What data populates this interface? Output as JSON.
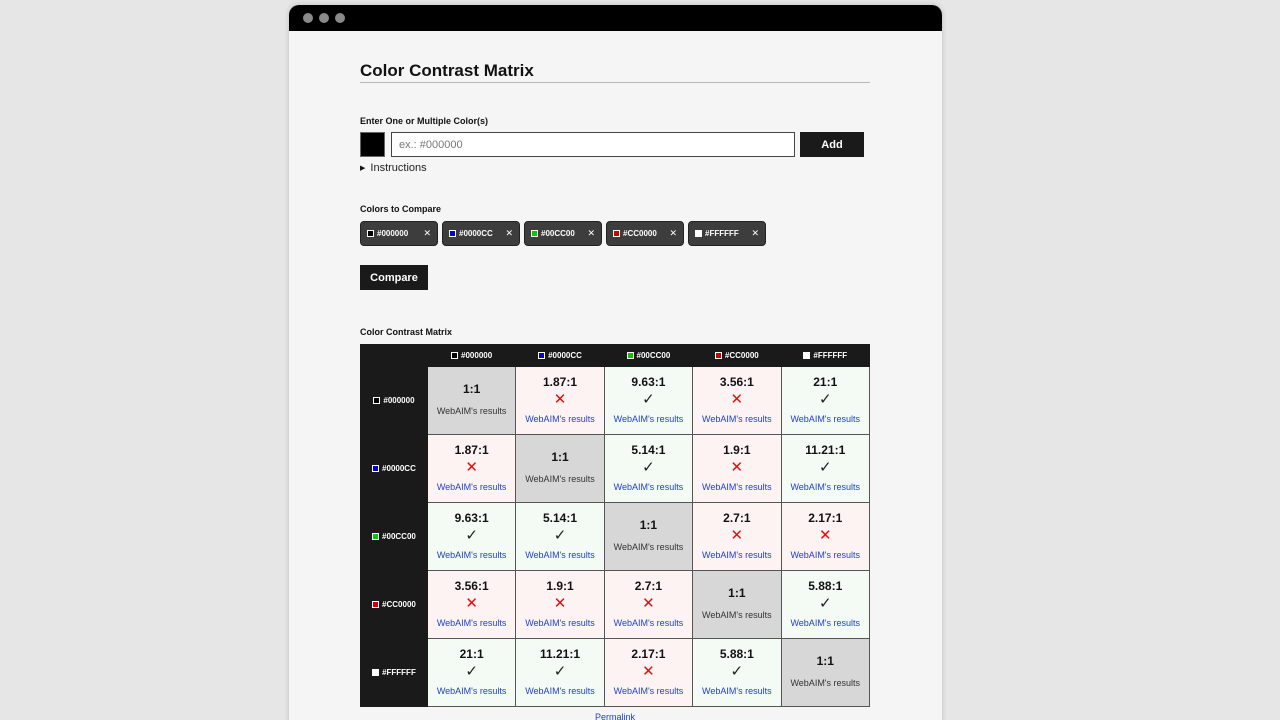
{
  "page": {
    "title": "Color Contrast Matrix",
    "enter_label": "Enter One or Multiple Color(s)",
    "input_placeholder": "ex.: #000000",
    "add_label": "Add",
    "instructions_label": "Instructions",
    "compare_colors_label": "Colors to Compare",
    "compare_button": "Compare",
    "matrix_label": "Color Contrast Matrix",
    "permalink": "Permalink",
    "results_link": "WebAIM's results"
  },
  "colors": [
    {
      "hex": "#000000",
      "label": "#000000"
    },
    {
      "hex": "#0000CC",
      "label": "#0000CC"
    },
    {
      "hex": "#00CC00",
      "label": "#00CC00"
    },
    {
      "hex": "#CC0000",
      "label": "#CC0000"
    },
    {
      "hex": "#FFFFFF",
      "label": "#FFFFFF"
    }
  ],
  "chip_remove_icon": "close-icon",
  "matrix": [
    [
      "1:1",
      "1.87:1",
      "9.63:1",
      "3.56:1",
      "21:1"
    ],
    [
      "1.87:1",
      "1:1",
      "5.14:1",
      "1.9:1",
      "11.21:1"
    ],
    [
      "9.63:1",
      "5.14:1",
      "1:1",
      "2.7:1",
      "2.17:1"
    ],
    [
      "3.56:1",
      "1.9:1",
      "2.7:1",
      "1:1",
      "5.88:1"
    ],
    [
      "21:1",
      "11.21:1",
      "2.17:1",
      "5.88:1",
      "1:1"
    ]
  ],
  "status": [
    [
      "same",
      "fail",
      "pass",
      "fail",
      "pass"
    ],
    [
      "fail",
      "same",
      "pass",
      "fail",
      "pass"
    ],
    [
      "pass",
      "pass",
      "same",
      "fail",
      "fail"
    ],
    [
      "fail",
      "fail",
      "fail",
      "same",
      "pass"
    ],
    [
      "pass",
      "pass",
      "fail",
      "pass",
      "same"
    ]
  ],
  "icons": {
    "pass": "✓",
    "fail": "✕"
  }
}
